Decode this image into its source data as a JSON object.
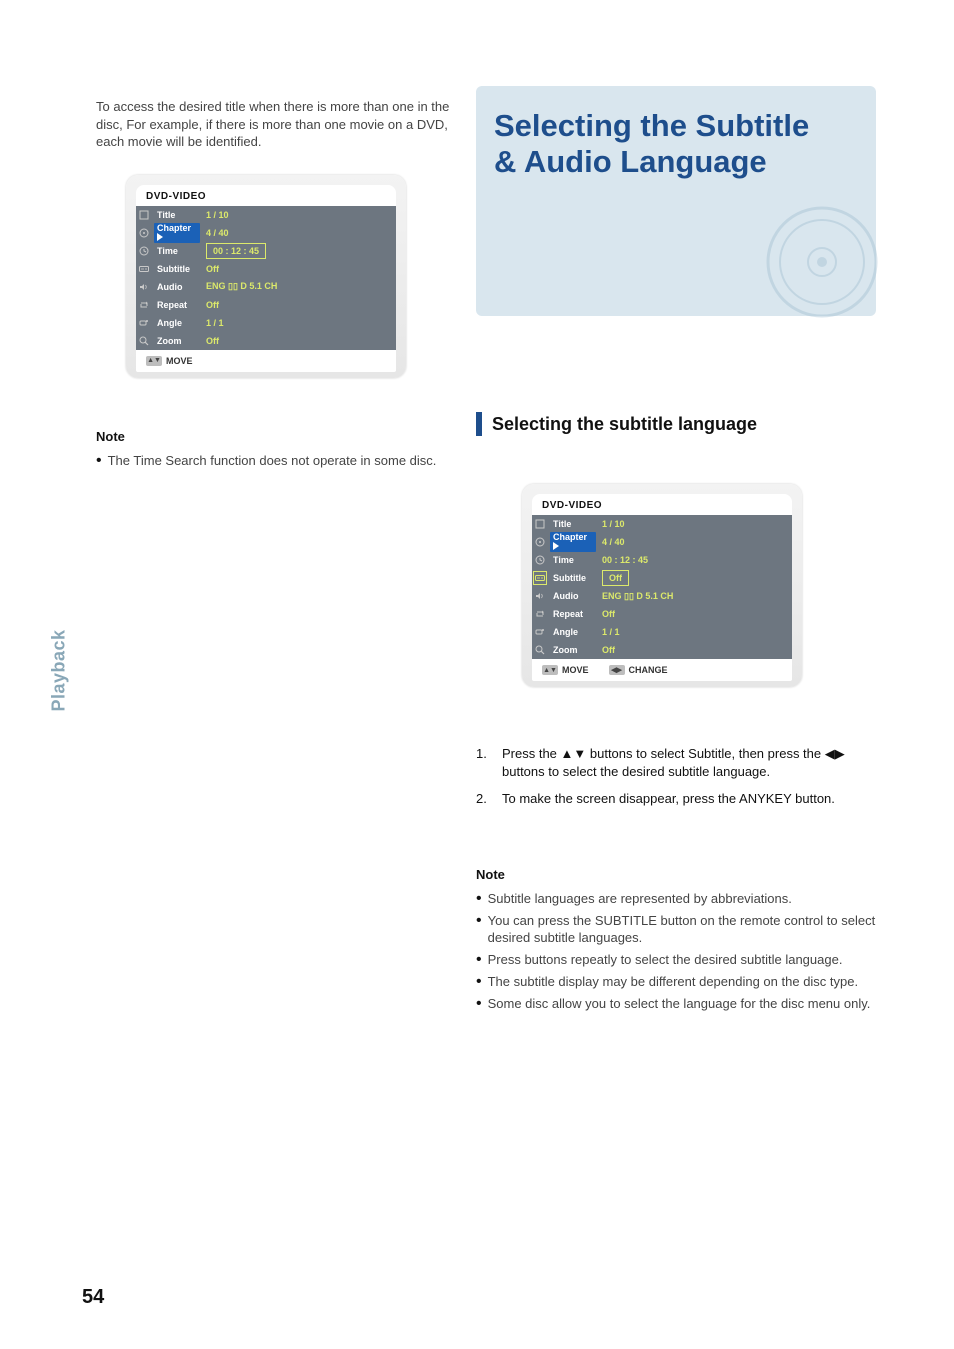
{
  "pageNumber": "54",
  "sideTab": "Playback",
  "left": {
    "leadIn": "To access the desired title when there is more than one in the disc, For example, if there is more than one movie on a DVD, each movie will be identified.",
    "osdA": {
      "header": "DVD-VIDEO",
      "rows": [
        {
          "icon": "title-icon",
          "label": "Title",
          "value": "1 / 10",
          "sel": false,
          "hl": false
        },
        {
          "icon": "disc-icon",
          "label": "Chapter",
          "value": "4 / 40",
          "sel": true,
          "hl": false
        },
        {
          "icon": "clock-icon",
          "label": "Time",
          "value": "00 : 12 : 45",
          "sel": false,
          "hl": true
        },
        {
          "icon": "subtitle-icon",
          "label": "Subtitle",
          "value": "Off",
          "sel": false,
          "hl": false
        },
        {
          "icon": "speaker-icon",
          "label": "Audio",
          "value": "ENG ▯▯ D 5.1 CH",
          "sel": false,
          "hl": false,
          "dolby": true
        },
        {
          "icon": "repeat-icon",
          "label": "Repeat",
          "value": "Off",
          "sel": false,
          "hl": false
        },
        {
          "icon": "angle-icon",
          "label": "Angle",
          "value": "1 / 1",
          "sel": false,
          "hl": false
        },
        {
          "icon": "zoom-icon",
          "label": "Zoom",
          "value": "Off",
          "sel": false,
          "hl": false
        }
      ],
      "footerMove": "MOVE",
      "footerMoveChip": "▲▼"
    },
    "noteLabel": "Note",
    "noteText": "The Time Search function does not operate in some disc."
  },
  "right": {
    "titleLine1": "Selecting the Subtitle",
    "titleLine2": "& Audio Language",
    "subhead": "Selecting the subtitle language",
    "osdB": {
      "header": "DVD-VIDEO",
      "rows": [
        {
          "icon": "title-icon",
          "label": "Title",
          "value": "1 / 10",
          "sel": false,
          "hl": false
        },
        {
          "icon": "disc-icon",
          "label": "Chapter",
          "value": "4 / 40",
          "sel": true,
          "hl": false
        },
        {
          "icon": "clock-icon",
          "label": "Time",
          "value": "00 : 12 : 45",
          "sel": false,
          "hl": false
        },
        {
          "icon": "subtitle-icon",
          "label": "Subtitle",
          "value": "Off",
          "sel": false,
          "hl": true,
          "iconHL": true
        },
        {
          "icon": "speaker-icon",
          "label": "Audio",
          "value": "ENG ▯▯ D 5.1 CH",
          "sel": false,
          "hl": false,
          "dolby": true
        },
        {
          "icon": "repeat-icon",
          "label": "Repeat",
          "value": "Off",
          "sel": false,
          "hl": false
        },
        {
          "icon": "angle-icon",
          "label": "Angle",
          "value": "1 / 1",
          "sel": false,
          "hl": false
        },
        {
          "icon": "zoom-icon",
          "label": "Zoom",
          "value": "Off",
          "sel": false,
          "hl": false
        }
      ],
      "footerMove": "MOVE",
      "footerMoveChip": "▲▼",
      "footerChange": "CHANGE",
      "footerChangeChip": "◀▶"
    },
    "steps": [
      {
        "n": "1.",
        "t": "Press the ▲▼ buttons to select Subtitle, then press the ◀▶ buttons to select the desired subtitle language."
      },
      {
        "n": "2.",
        "t": "To make the screen disappear, press the ANYKEY button."
      }
    ],
    "noteLabel": "Note",
    "notes": [
      "Subtitle languages are represented by abbreviations.",
      "You can press the SUBTITLE button on the remote control to select desired subtitle languages.",
      "Press buttons repeatly to select the desired subtitle language.",
      "The subtitle display may be different depending on the disc type.",
      "Some disc allow you to select the language for the disc menu only."
    ]
  }
}
